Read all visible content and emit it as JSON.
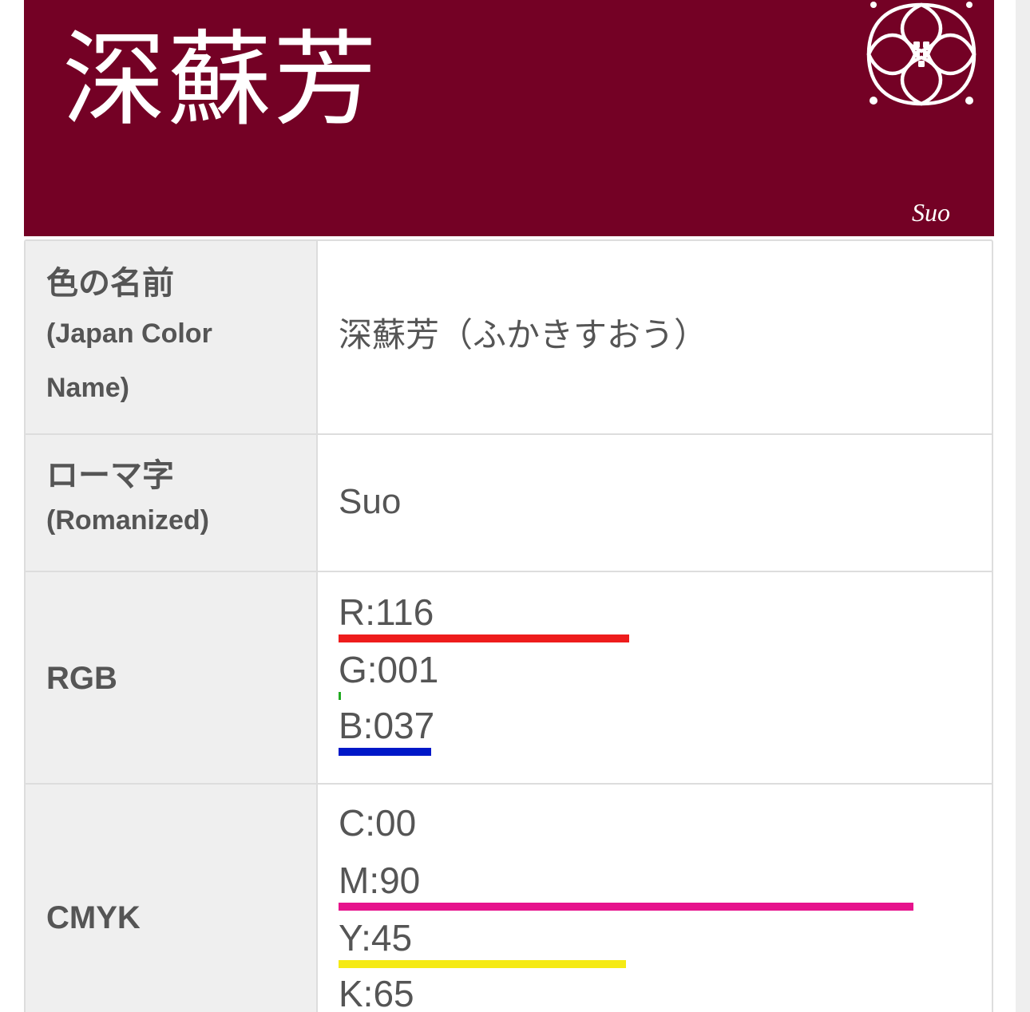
{
  "colors": {
    "banner_bg": "#740125",
    "banner_text": "#ffffff",
    "red_bar": "#ee1c1c",
    "blue_bar": "#0018c8",
    "magenta_bar": "#e6138c",
    "yellow_bar": "#f5ea14"
  },
  "header": {
    "title": "深蘇芳",
    "romanized": "Suo",
    "emblem_icon": "shippo-crest-icon"
  },
  "table": {
    "name_row": {
      "label_ja": "色の名前",
      "label_en": "(Japan Color\nName)",
      "value": "深蘇芳（ふかきすおう）"
    },
    "roman_row": {
      "label_ja": "ローマ字",
      "label_en": "(Romanized)",
      "value": "Suo"
    },
    "rgb_row": {
      "label": "RGB",
      "r": {
        "text": "R:116",
        "value": 116,
        "max": 255
      },
      "g": {
        "text": "G:001",
        "value": 1,
        "max": 255
      },
      "b": {
        "text": "B:037",
        "value": 37,
        "max": 255
      }
    },
    "cmyk_row": {
      "label": "CMYK",
      "c": {
        "text": "C:00",
        "value": 0,
        "max": 100
      },
      "m": {
        "text": "M:90",
        "value": 90,
        "max": 100
      },
      "y": {
        "text": "Y:45",
        "value": 45,
        "max": 100
      },
      "k": {
        "text": "K:65",
        "value": 65,
        "max": 100
      }
    }
  }
}
